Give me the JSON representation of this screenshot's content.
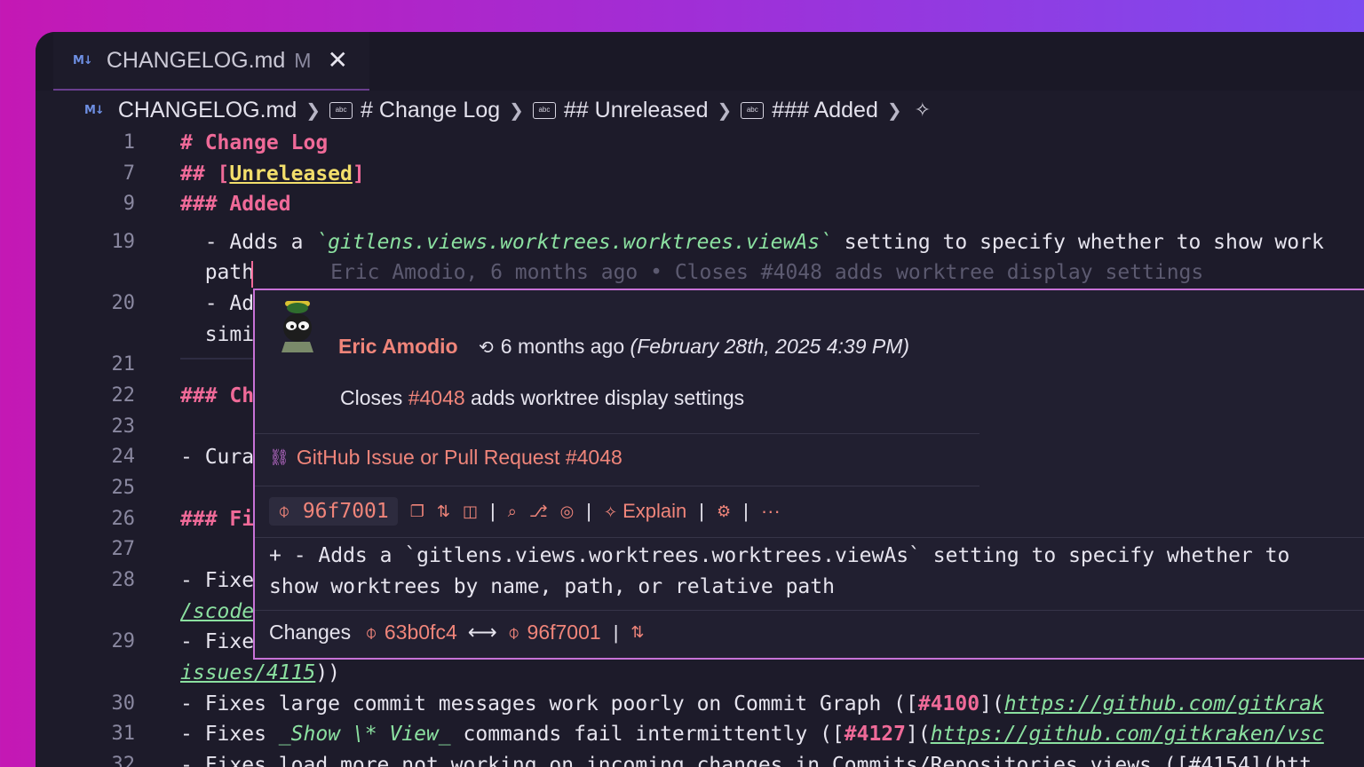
{
  "tab": {
    "name": "CHANGELOG.md",
    "modified": "M",
    "close": "✕",
    "icon": "M↓"
  },
  "breadcrumb": {
    "file": "CHANGELOG.md",
    "items": [
      "# Change Log",
      "## Unreleased",
      "### Added"
    ]
  },
  "lines": {
    "n1": "1",
    "n7": "7",
    "n9": "9",
    "n19": "19",
    "n20": "20",
    "n21": "21",
    "n22": "22",
    "n23": "23",
    "n24": "24",
    "n25": "25",
    "n26": "26",
    "n27": "27",
    "n28": "28",
    "n29": "29",
    "n30": "30",
    "n31": "31",
    "n32": "32",
    "l1": "# Change Log",
    "l7a": "## [",
    "l7b": "Unreleased",
    "l7c": "]",
    "l9": "### Added",
    "l19a": "  - Adds a ",
    "l19b": "`gitlens.views.worktrees.worktrees.viewAs`",
    "l19c": " setting to specify whether to show work",
    "l19w": "  path",
    "blame": "Eric Amodio, 6 months ago • Closes #4048 adds worktree display settings",
    "l20": "  - Ad",
    "l20w": "  simi",
    "l22": "### Ch",
    "l24": "- Cura",
    "l26": "### Fi",
    "l28": "- Fixe",
    "l28w": "/scode",
    "l29": "- Fixe",
    "l29wa": "issues/4115",
    "l29wb": "))",
    "l30a": "- Fixes large commit messages work poorly on Commit Graph ([",
    "l30b": "#4100",
    "l30c": "](",
    "l30d": "https://github.com/gitkrak",
    "l31a": "- Fixes ",
    "l31b": "_Show \\* View_",
    "l31c": " commands fail intermittently ([",
    "l31d": "#4127",
    "l31e": "](",
    "l31f": "https://github.com/gitkraken/vsc",
    "l32": "- Fixes load more not working on incoming changes in Commits/Repositories views ([#4154](htt"
  },
  "hover": {
    "author": "Eric Amodio",
    "relative": "6 months ago",
    "absolute": "(February 28th, 2025 4:39 PM)",
    "msg_a": "Closes ",
    "msg_num": "#4048",
    "msg_b": " adds worktree display settings",
    "pr_label": "GitHub Issue or Pull Request #4048",
    "sha": "96f7001",
    "explain": "Explain",
    "more": "···",
    "diff1": "+ - Adds a `gitlens.views.worktrees.worktrees.viewAs` setting to specify whether to",
    "diff2": "show worktrees by name, path, or relative path",
    "changes_label": "Changes",
    "from_sha": "63b0fc4",
    "arrow": "⟷",
    "to_sha": "96f7001"
  },
  "colors": {
    "accent": "#f0857a",
    "heading": "#ef6a98",
    "border": "#c772d6"
  }
}
